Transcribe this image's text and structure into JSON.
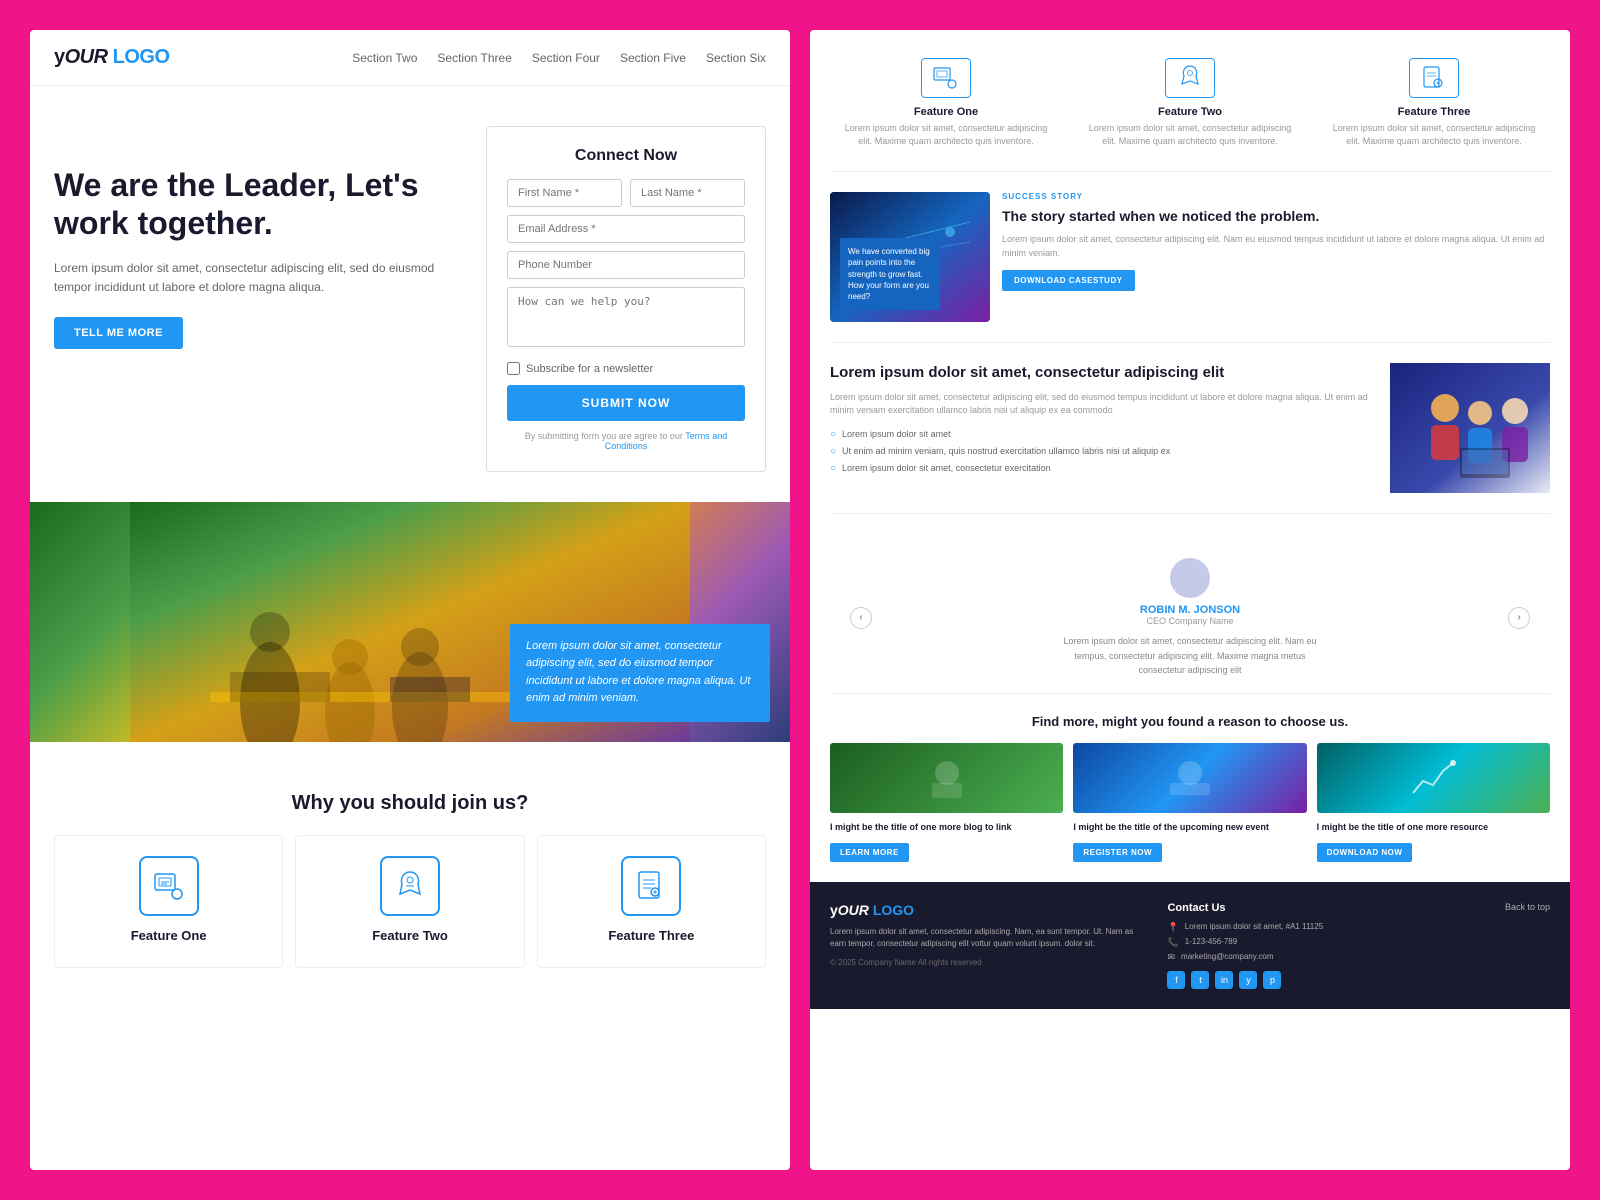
{
  "meta": {
    "bg_color": "#f0148a"
  },
  "logo": {
    "your": "y",
    "our": "OUR",
    "logo": "LOGO"
  },
  "nav": {
    "links": [
      {
        "label": "Section Two"
      },
      {
        "label": "Section Three"
      },
      {
        "label": "Section Four"
      },
      {
        "label": "Section Five"
      },
      {
        "label": "Section Six"
      }
    ]
  },
  "hero": {
    "title": "We are the Leader, Let's work together.",
    "description": "Lorem ipsum dolor sit amet, consectetur adipiscing elit, sed do eiusmod tempor incididunt ut labore et dolore magna aliqua.",
    "cta_label": "TELL ME MORE"
  },
  "connect_form": {
    "title": "Connect Now",
    "first_name_placeholder": "First Name *",
    "last_name_placeholder": "Last Name *",
    "email_placeholder": "Email Address *",
    "phone_placeholder": "Phone Number",
    "message_placeholder": "How can we help you?",
    "subscribe_label": "Subscribe for a newsletter",
    "submit_label": "SUBMIT NOW",
    "disclaimer": "By submitting form you are agree to our ",
    "disclaimer_link": "Terms and Conditions"
  },
  "photo_caption": "Lorem ipsum dolor sit amet, consectetur adipiscing elit, sed do eiusmod tempor incididunt ut labore et dolore magna aliqua. Ut enim ad minim veniam.",
  "why_join": {
    "title": "Why you should join us?",
    "features": [
      {
        "name": "Feature One"
      },
      {
        "name": "Feature Two"
      },
      {
        "name": "Feature Three"
      }
    ]
  },
  "top_features": [
    {
      "name": "Feature One",
      "desc": "Lorem ipsum dolor sit amet, consectetur adipiscing elit. Maxime quam architecto quis inventore."
    },
    {
      "name": "Feature Two",
      "desc": "Lorem ipsum dolor sit amet, consectetur adipiscing elit. Maxime quam architecto quis inventore."
    },
    {
      "name": "Feature Three",
      "desc": "Lorem ipsum dolor sit amet, consectetur adipiscing elit. Maxime quam architecto quis inventore."
    }
  ],
  "success_story": {
    "badge": "SUCCESS STORY",
    "title": "The story started when we noticed the problem.",
    "description": "Lorem ipsum dolor sit amet, consectetur adipiscing elit. Nam eu eiusmod tempus incididunt ut labore et dolore magna aliqua. Ut enim ad minim veniam.",
    "overlay_text": "We have converted big pain points into the strength to grow fast. How your form are you need?",
    "btn_label": "DOWNLOAD CASESTUDY"
  },
  "about": {
    "title": "Lorem ipsum dolor sit amet, consectetur adipiscing elit",
    "description": "Lorem ipsum dolor sit amet, consectetur adipiscing elit, sed do eiusmod tempus incididunt ut labore et dolore magna aliqua. Ut enim ad minim veniam exercitation ullamco labris nisi ut aliquip ex ea commodo",
    "list_items": [
      "Lorem ipsum dolor sit amet",
      "Ut enim ad minim veniam, quis nostrud exercitation ullamco labris nisi ut aliquip ex",
      "Lorem ipsum dolor sit amet, consectetur exercitation"
    ]
  },
  "testimonial": {
    "name": "ROBIN M. JONSON",
    "role": "CEO Company Name",
    "text": "Lorem ipsum dolor sit amet, consectetur adipiscing elit. Nam eu tempus, consectetur adipiscing elit. Maxime magna metus consectetur adipiscing elit"
  },
  "find_more": {
    "title": "Find more, might you found a reason to choose us.",
    "cards": [
      {
        "title": "I might be the title of one more blog to link",
        "btn_label": "LEARN MORE"
      },
      {
        "title": "I might be the title of the upcoming new event",
        "btn_label": "REGISTER NOW"
      },
      {
        "title": "I might be the title of one more resource",
        "btn_label": "DOWNLOAD NOW"
      }
    ]
  },
  "footer": {
    "brand_desc": "Lorem ipsum dolor sit amet, consectetur adipiscing. Nam, ea sunt tempor. Ut. Nam as earn tempor, consectetur adipiscing elit vottur quam volunt ipsum. dolor sit.",
    "copyright": "© 2025 Company Name All rights reserved",
    "contact_title": "Contact Us",
    "address": "Lorem ipsum dolor sit amet, #A1 11125",
    "phone": "1-123-456-789",
    "email": "marketing@company.com",
    "back_to_top": "Back to top",
    "social_icons": [
      "f",
      "t",
      "in",
      "y",
      "p"
    ]
  }
}
